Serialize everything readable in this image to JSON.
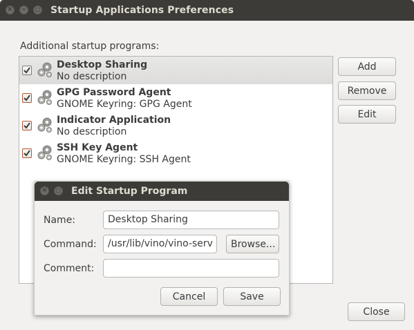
{
  "window": {
    "title": "Startup Applications Preferences"
  },
  "main": {
    "section_label": "Additional startup programs:",
    "programs": [
      {
        "name": "Desktop Sharing",
        "description": "No description",
        "enabled": true,
        "selected": true
      },
      {
        "name": "GPG Password Agent",
        "description": "GNOME Keyring: GPG Agent",
        "enabled": true,
        "selected": false
      },
      {
        "name": "Indicator Application",
        "description": "No description",
        "enabled": true,
        "selected": false
      },
      {
        "name": "SSH Key Agent",
        "description": "GNOME Keyring: SSH Agent",
        "enabled": true,
        "selected": false
      }
    ],
    "buttons": {
      "add": "Add",
      "remove": "Remove",
      "edit": "Edit",
      "close": "Close"
    }
  },
  "dialog": {
    "title": "Edit Startup Program",
    "name_label": "Name:",
    "name_value": "Desktop Sharing",
    "command_label": "Command:",
    "command_value": "/usr/lib/vino/vino-serv",
    "browse_label": "Browse...",
    "comment_label": "Comment:",
    "comment_value": "",
    "cancel_label": "Cancel",
    "save_label": "Save"
  },
  "colors": {
    "titlebar": "#3c3b37",
    "checkbox_accent": "#b5552f"
  },
  "icons": {
    "program_icon": "gears-icon",
    "checkbox_mark": "checkmark-icon"
  }
}
